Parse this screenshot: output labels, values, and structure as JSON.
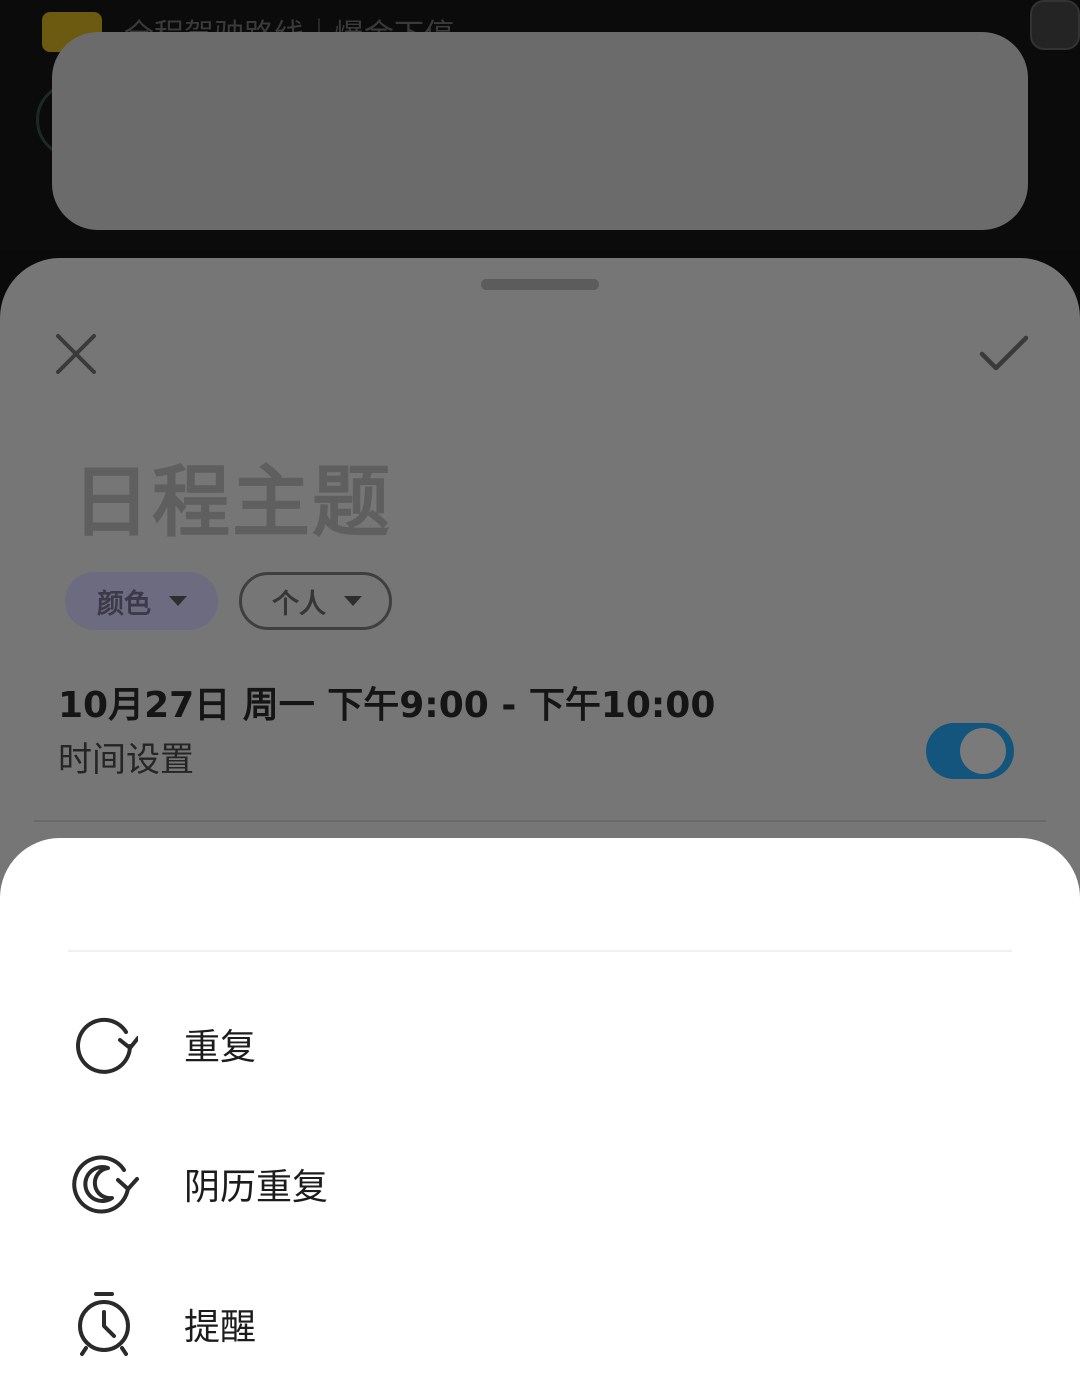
{
  "background": {
    "notification_text": "全程驾驶路线｜爆金下停"
  },
  "editor": {
    "title_placeholder": "日程主题",
    "chips": {
      "color_label": "颜色",
      "calendar_label": "个人"
    },
    "datetime": "10月27日 周一 下午9:00 - 下午10:00",
    "time_setting_label": "时间设置",
    "all_day_toggle": {
      "on": true,
      "color": "#14557e"
    }
  },
  "menu": {
    "items": [
      {
        "label": "重复",
        "icon": "repeat-icon"
      },
      {
        "label": "阴历重复",
        "icon": "lunar-repeat-icon"
      },
      {
        "label": "提醒",
        "icon": "reminder-alarm-icon"
      }
    ]
  }
}
